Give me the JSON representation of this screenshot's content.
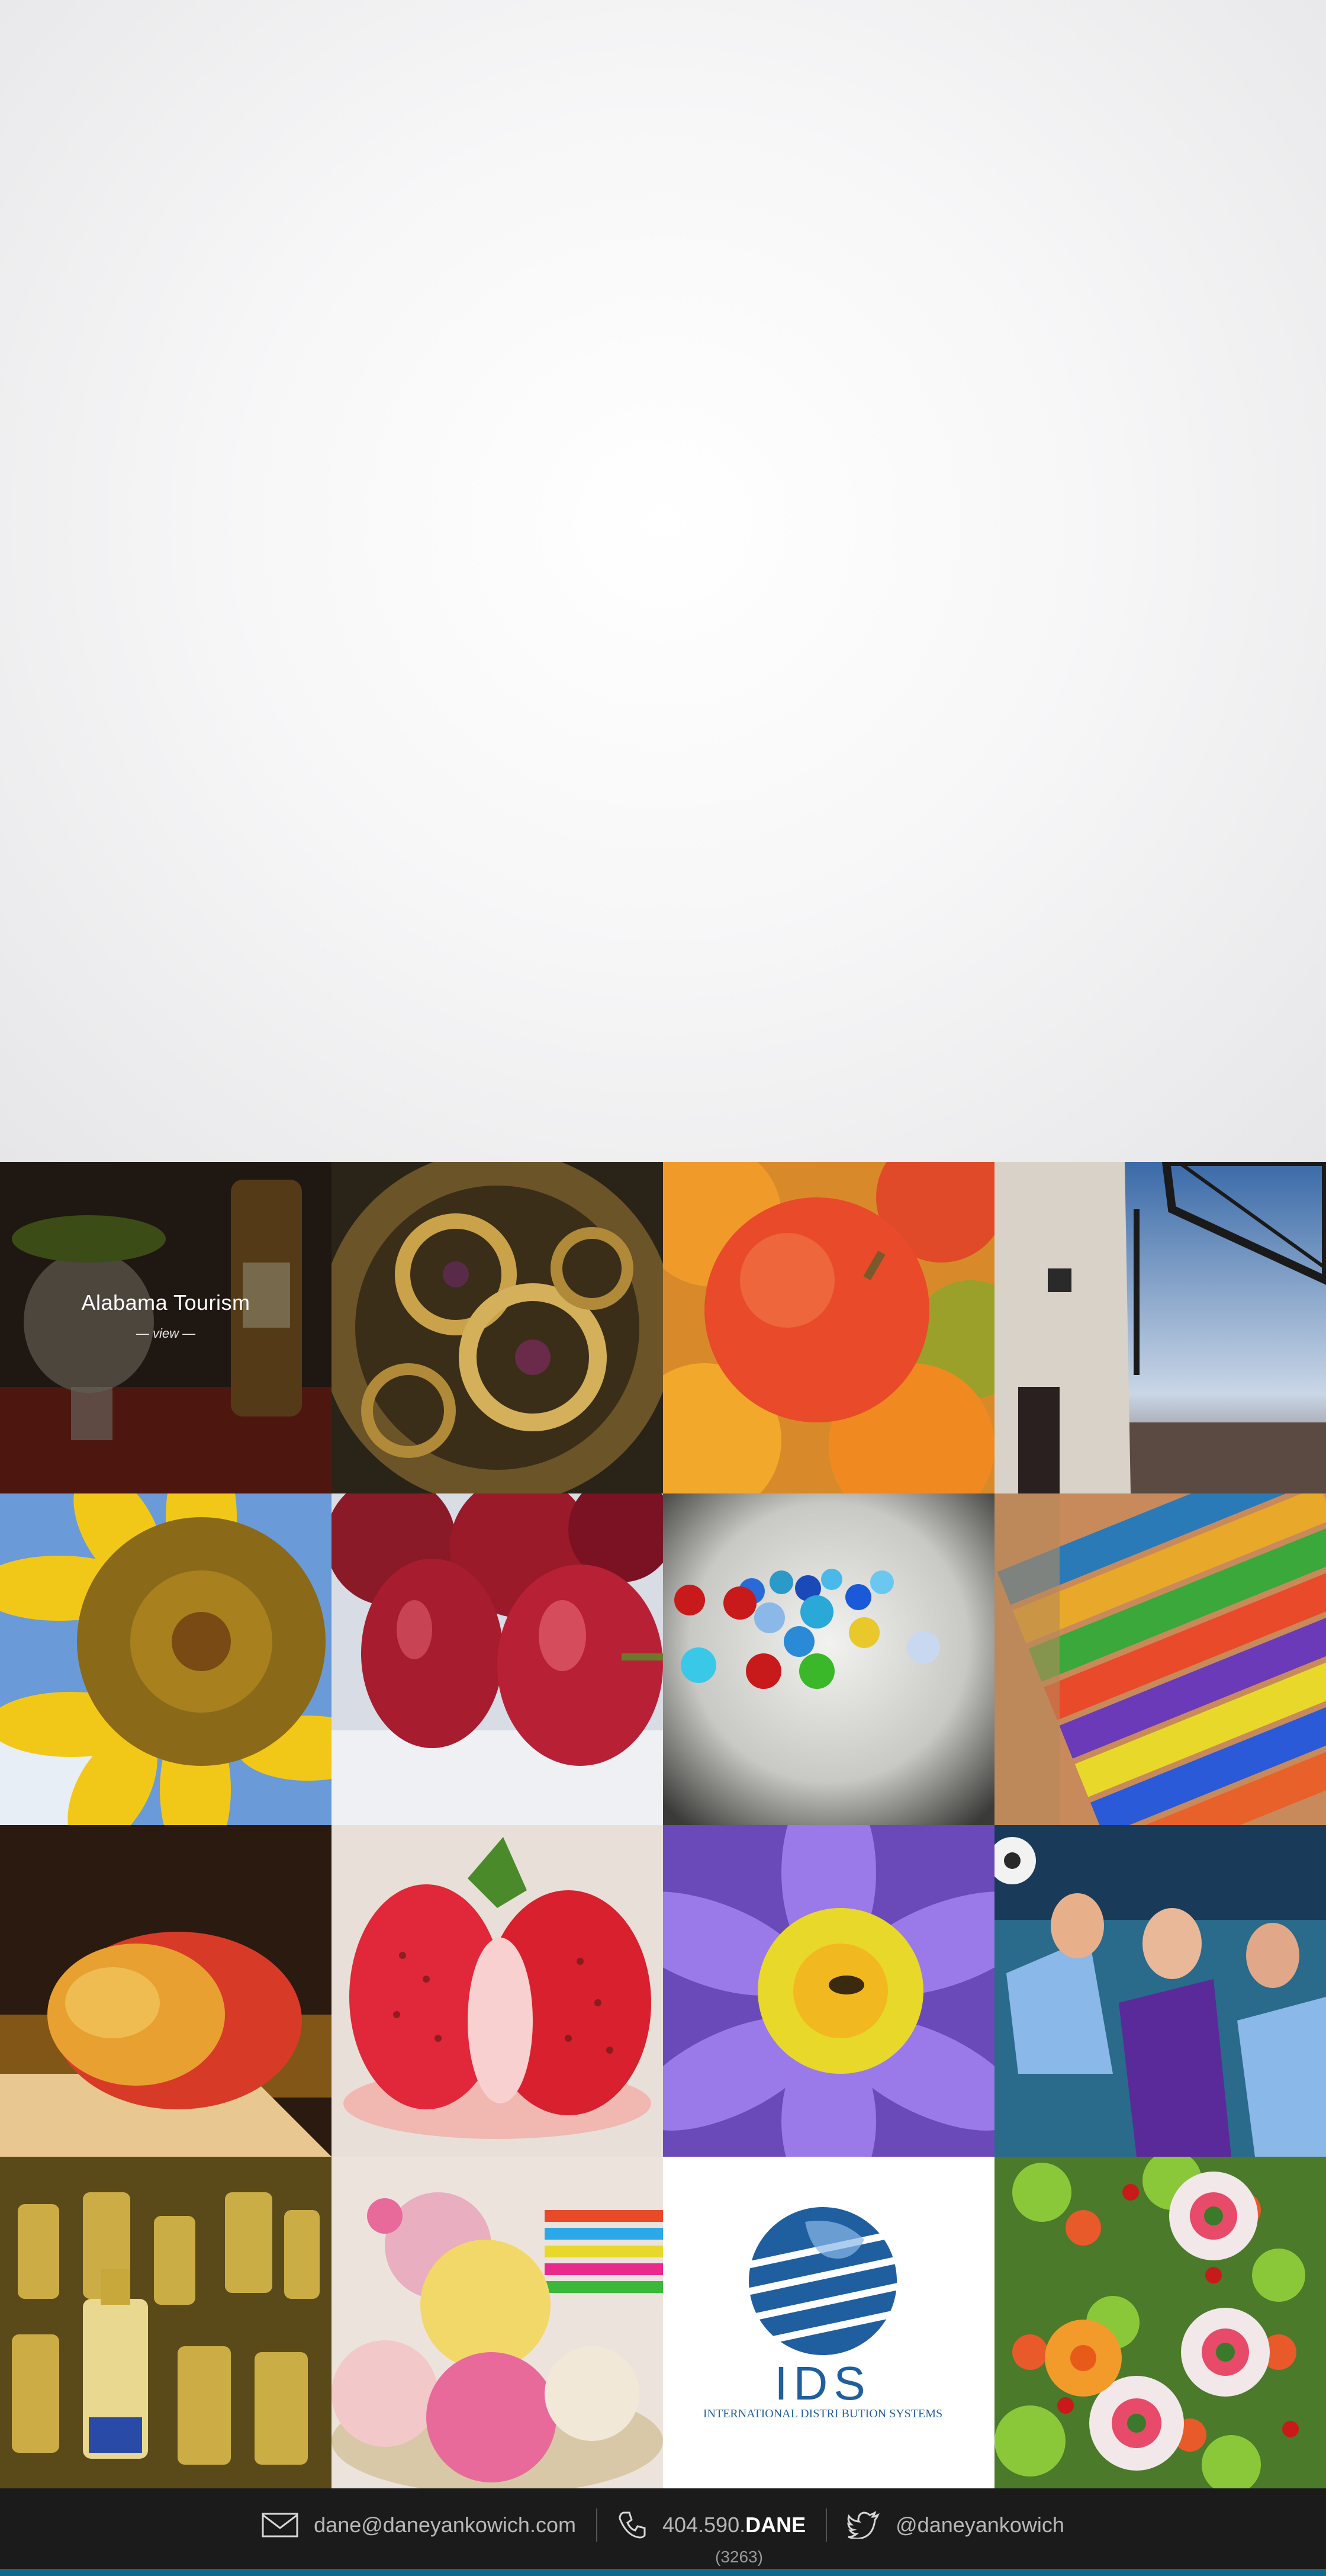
{
  "portfolio": {
    "featured_tile": {
      "title": "Alabama Tourism",
      "view_label": "— view —"
    },
    "tiles": [
      {
        "icon": "cat-tequila-image"
      },
      {
        "icon": "watch-gears-image"
      },
      {
        "icon": "fruit-image"
      },
      {
        "icon": "windmill-image"
      },
      {
        "icon": "sunflower-image"
      },
      {
        "icon": "cherries-image"
      },
      {
        "icon": "marbles-image"
      },
      {
        "icon": "colored-pencils-image"
      },
      {
        "icon": "mango-image"
      },
      {
        "icon": "strawberry-image"
      },
      {
        "icon": "lotus-flower-image"
      },
      {
        "icon": "soccer-players-image"
      },
      {
        "icon": "perfume-bottles-image"
      },
      {
        "icon": "yarn-balls-image"
      },
      {
        "icon": "ids-logo"
      },
      {
        "icon": "flower-bouquet-image"
      }
    ],
    "ids_logo": {
      "letters": "IDS",
      "tagline": "INTERNATIONAL DISTRI BUTION SYSTEMS"
    }
  },
  "footer": {
    "email": "dane@daneyankowich.com",
    "phone_prefix": "404.590.",
    "phone_word": "DANE",
    "phone_digits": "(3263)",
    "twitter": "@daneyankowich"
  },
  "colors": {
    "footer_background": "#1b1b1c",
    "footer_accent_bar": "#0f6a8f",
    "ids_blue": "#1f5f9f"
  }
}
